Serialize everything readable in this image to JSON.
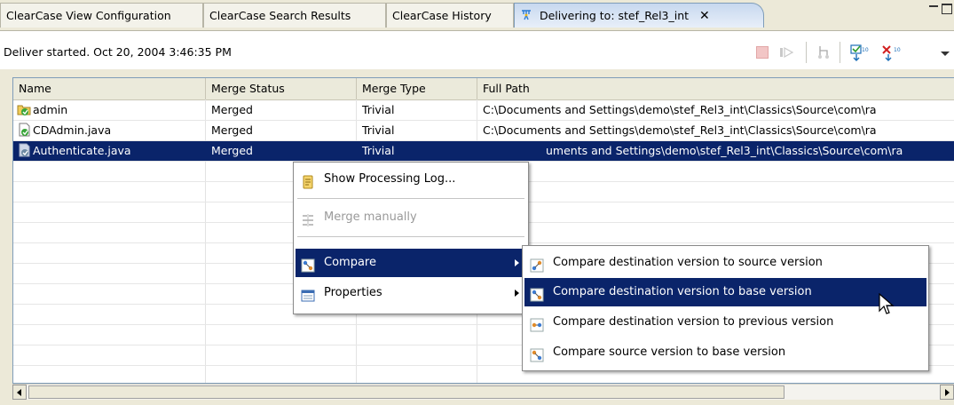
{
  "tabs": [
    {
      "label": "ClearCase View Configuration",
      "active": false
    },
    {
      "label": "ClearCase Search Results",
      "active": false
    },
    {
      "label": "ClearCase History",
      "active": false
    },
    {
      "label": "Delivering to: stef_Rel3_int",
      "active": true,
      "closable": true
    }
  ],
  "status": {
    "message": "Deliver started. Oct 20, 2004 3:46:35 PM"
  },
  "table": {
    "columns": [
      "Name",
      "Merge Status",
      "Merge Type",
      "Full Path"
    ],
    "rows": [
      {
        "name": "admin",
        "merge_status": "Merged",
        "merge_type": "Trivial",
        "full_path": "C:\\Documents and Settings\\demo\\stef_Rel3_int\\Classics\\Source\\com\\ra"
      },
      {
        "name": "CDAdmin.java",
        "merge_status": "Merged",
        "merge_type": "Trivial",
        "full_path": "C:\\Documents and Settings\\demo\\stef_Rel3_int\\Classics\\Source\\com\\ra"
      },
      {
        "name": "Authenticate.java",
        "merge_status": "Merged",
        "merge_type": "Trivial",
        "full_path": "uments and Settings\\demo\\stef_Rel3_int\\Classics\\Source\\com\\ra",
        "selected": true
      }
    ]
  },
  "context_menu": {
    "items": [
      {
        "label": "Show Processing Log...",
        "icon": "log-icon",
        "enabled": true
      },
      {
        "label": "Merge manually",
        "icon": "merge-icon",
        "enabled": false
      },
      {
        "label": "Compare",
        "icon": "compare-icon",
        "enabled": true,
        "highlighted": true,
        "submenu": true
      },
      {
        "label": "Properties",
        "icon": "properties-icon",
        "enabled": true,
        "submenu": true
      }
    ]
  },
  "compare_submenu": {
    "items": [
      {
        "label": "Compare destination version to source version",
        "icon": "compare-src-icon"
      },
      {
        "label": "Compare destination version to base version",
        "icon": "compare-base-icon",
        "highlighted": true
      },
      {
        "label": "Compare destination version to previous version",
        "icon": "compare-prev-icon"
      },
      {
        "label": "Compare source version to base version",
        "icon": "compare-source-base-icon"
      }
    ]
  },
  "colors": {
    "selection": "#0a246a",
    "tab_active": "#c7d8ef",
    "chrome": "#ece9d8"
  }
}
